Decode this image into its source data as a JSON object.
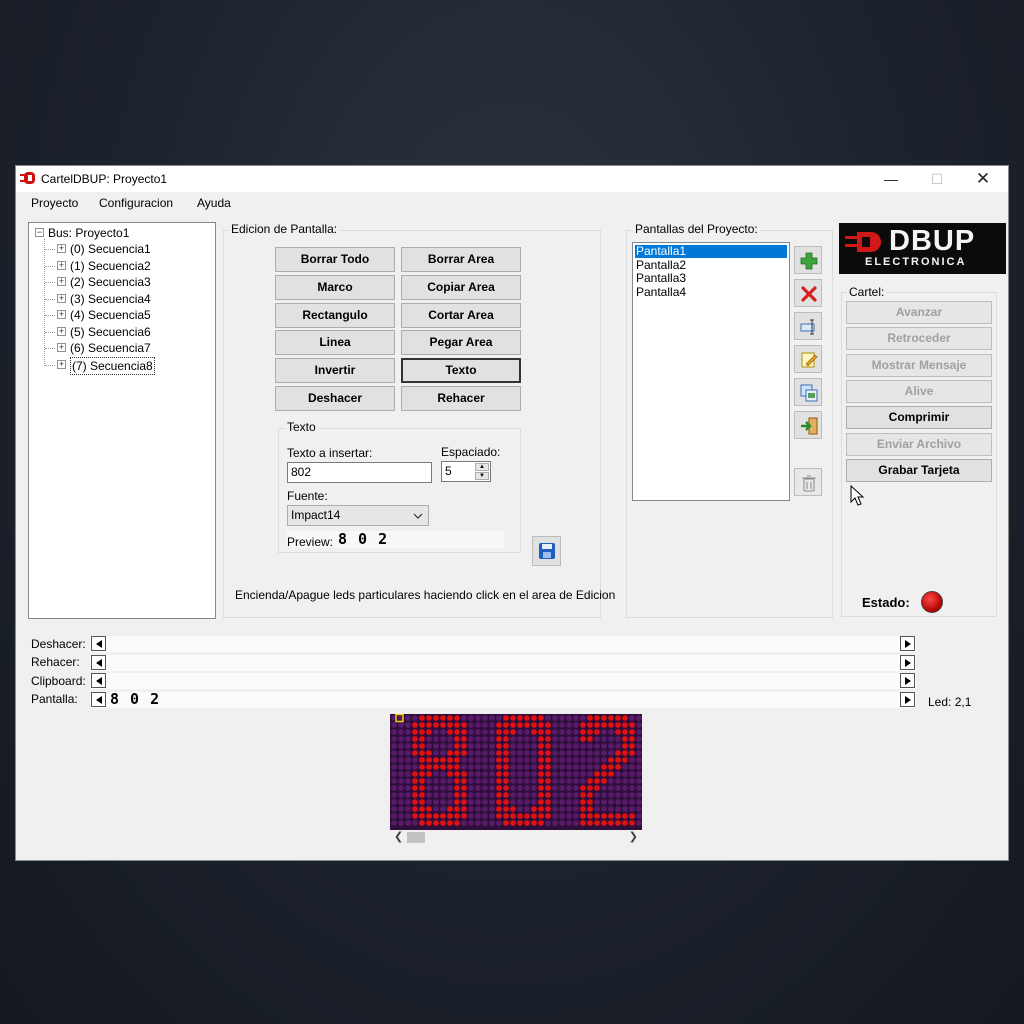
{
  "window": {
    "title": "CartelDBUP: Proyecto1",
    "accent": "#cc1111"
  },
  "menu": [
    "Proyecto",
    "Configuracion",
    "Ayuda"
  ],
  "tree": {
    "root": "Bus: Proyecto1",
    "items": [
      "(0) Secuencia1",
      "(1) Secuencia2",
      "(2) Secuencia3",
      "(3) Secuencia4",
      "(4) Secuencia5",
      "(5) Secuencia6",
      "(6) Secuencia7",
      "(7) Secuencia8"
    ],
    "selected_index": 7
  },
  "edicion": {
    "title": "Edicion de Pantalla:",
    "buttons": [
      "Borrar Todo",
      "Borrar Area",
      "Marco",
      "Copiar Area",
      "Rectangulo",
      "Cortar Area",
      "Linea",
      "Pegar Area",
      "Invertir",
      "Texto",
      "Deshacer",
      "Rehacer"
    ],
    "focused_button": "Texto",
    "texto": {
      "group_title": "Texto",
      "insert_label": "Texto a insertar:",
      "insert_value": "802",
      "spacing_label": "Espaciado:",
      "spacing_value": "5",
      "font_label": "Fuente:",
      "font_value": "Impact14",
      "preview_label": "Preview:",
      "preview_text": "8 0 2"
    },
    "hint": "Encienda/Apague leds particulares haciendo click en el area de Edicion"
  },
  "pantallas": {
    "title": "Pantallas del Proyecto:",
    "items": [
      "Pantalla1",
      "Pantalla2",
      "Pantalla3",
      "Pantalla4"
    ],
    "selected_index": 0,
    "tool_icons": [
      "add-icon",
      "delete-icon",
      "rename-icon",
      "edit-icon",
      "copy-icon",
      "export-icon",
      "trash-icon"
    ]
  },
  "logo": {
    "top": "DBUP",
    "bottom": "ELECTRONICA"
  },
  "cartel": {
    "title": "Cartel:",
    "buttons": [
      {
        "label": "Avanzar",
        "enabled": false
      },
      {
        "label": "Retroceder",
        "enabled": false
      },
      {
        "label": "Mostrar Mensaje",
        "enabled": false
      },
      {
        "label": "Alive",
        "enabled": false
      },
      {
        "label": "Comprimir",
        "enabled": true
      },
      {
        "label": "Enviar Archivo",
        "enabled": false
      },
      {
        "label": "Grabar Tarjeta",
        "enabled": true
      }
    ],
    "estado_label": "Estado:",
    "estado_color": "#cc0000"
  },
  "strips": {
    "deshacer": "Deshacer:",
    "rehacer": "Rehacer:",
    "clipboard": "Clipboard:",
    "pantalla": "Pantalla:",
    "pantalla_preview": "8 0 2",
    "led_label": "Led: 2,1"
  },
  "display": {
    "text": "802",
    "on_color": "#e01010",
    "off_color": "#5a1a6a",
    "background": "#2e0f3c"
  }
}
